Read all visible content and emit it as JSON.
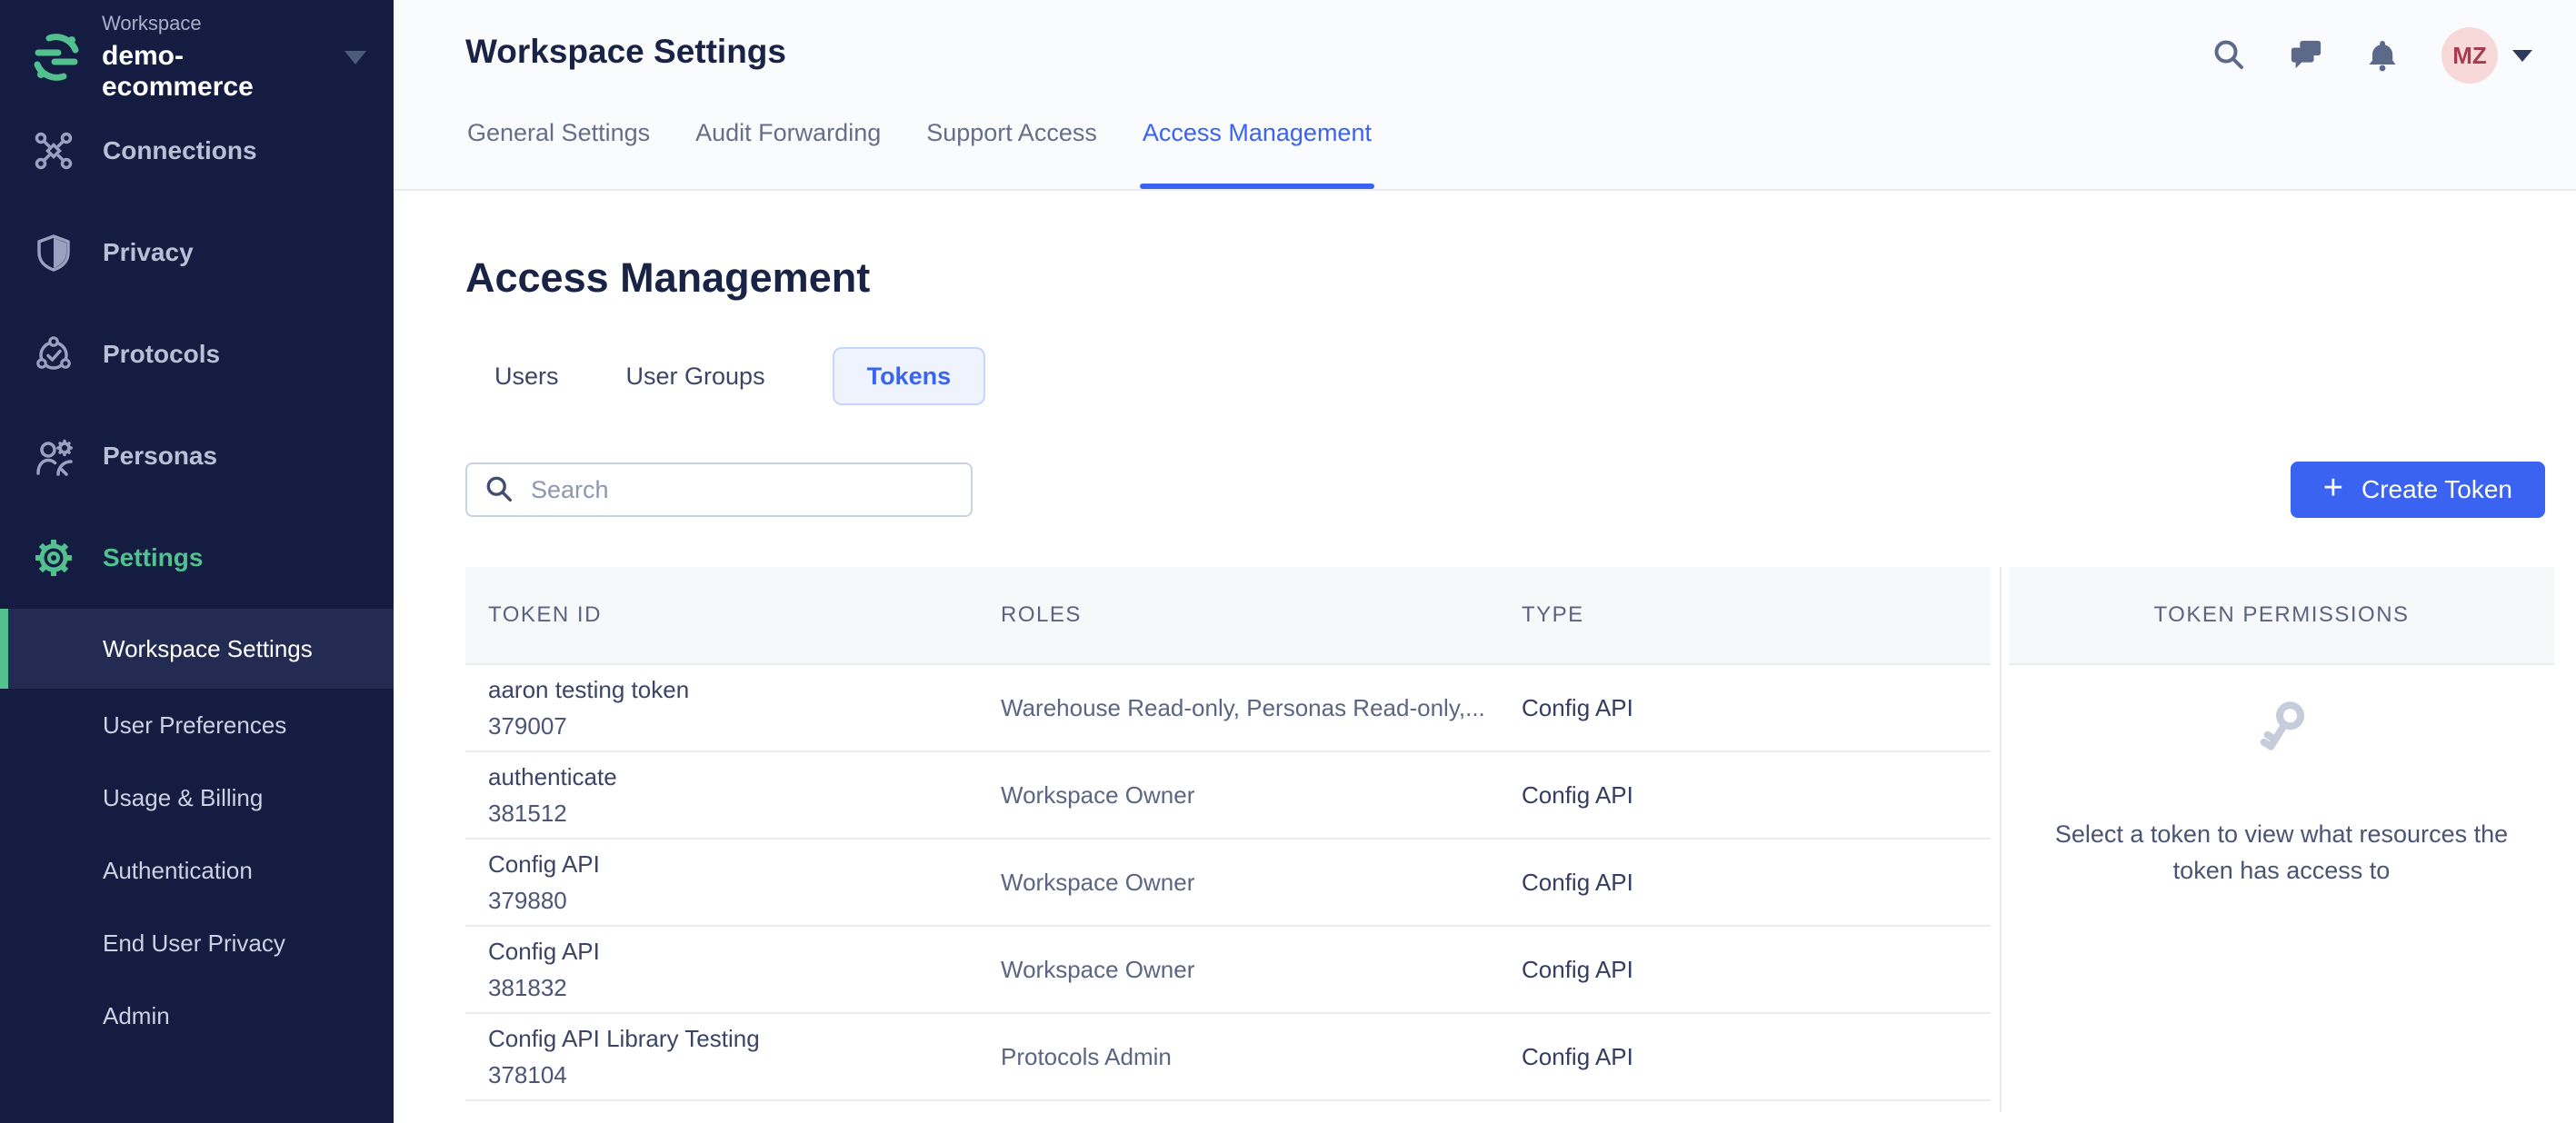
{
  "colors": {
    "sidebar_bg": "#141c41",
    "sidebar_active_bg": "#232b52",
    "brand_green": "#52c08f",
    "accent_blue": "#3a63f2",
    "active_pill_bg": "#eef3fe",
    "active_pill_border": "#c5d5fb",
    "topbar_bg": "#fafbfd",
    "table_header_bg": "#f7f8fa",
    "row_border": "#e9ecf3",
    "avatar_bg": "#f7d9d9",
    "avatar_text": "#a63c4e",
    "heading_text": "#192346"
  },
  "sidebar": {
    "logo_icon": "segment-logo-icon",
    "workspace_label": "Workspace",
    "workspace_name": "demo-ecommerce",
    "items": [
      {
        "label": "Connections",
        "icon": "connections-icon",
        "active": false
      },
      {
        "label": "Privacy",
        "icon": "privacy-shield-icon",
        "active": false
      },
      {
        "label": "Protocols",
        "icon": "protocols-icon",
        "active": false
      },
      {
        "label": "Personas",
        "icon": "personas-icon",
        "active": false
      },
      {
        "label": "Settings",
        "icon": "settings-gear-icon",
        "active": true
      }
    ],
    "settings_subitems": [
      {
        "label": "Workspace Settings",
        "active": true
      },
      {
        "label": "User Preferences",
        "active": false
      },
      {
        "label": "Usage & Billing",
        "active": false
      },
      {
        "label": "Authentication",
        "active": false
      },
      {
        "label": "End User Privacy",
        "active": false
      },
      {
        "label": "Admin",
        "active": false
      }
    ]
  },
  "topbar": {
    "title": "Workspace Settings",
    "tabs": [
      {
        "label": "General Settings",
        "active": false
      },
      {
        "label": "Audit Forwarding",
        "active": false
      },
      {
        "label": "Support Access",
        "active": false
      },
      {
        "label": "Access Management",
        "active": true
      }
    ],
    "icons": [
      "search-icon",
      "chat-bubbles-icon",
      "bell-icon"
    ],
    "avatar_initials": "MZ"
  },
  "main": {
    "heading": "Access Management",
    "subtabs": [
      {
        "label": "Users",
        "active": false
      },
      {
        "label": "User Groups",
        "active": false
      },
      {
        "label": "Tokens",
        "active": true
      }
    ],
    "search_placeholder": "Search",
    "create_token_plus": "+",
    "create_token_label": "Create Token",
    "table": {
      "columns": [
        "TOKEN ID",
        "ROLES",
        "TYPE"
      ],
      "rows": [
        {
          "name": "aaron testing token",
          "id": "379007",
          "roles": "Warehouse Read-only, Personas Read-only,...",
          "type": "Config API"
        },
        {
          "name": "authenticate",
          "id": "381512",
          "roles": "Workspace Owner",
          "type": "Config API"
        },
        {
          "name": "Config API",
          "id": "379880",
          "roles": "Workspace Owner",
          "type": "Config API"
        },
        {
          "name": "Config API",
          "id": "381832",
          "roles": "Workspace Owner",
          "type": "Config API"
        },
        {
          "name": "Config API Library Testing",
          "id": "378104",
          "roles": "Protocols Admin",
          "type": "Config API"
        }
      ]
    },
    "permissions_panel": {
      "header": "TOKEN PERMISSIONS",
      "icon": "key-icon",
      "empty_message": "Select a token to view what resources the token has access to"
    }
  }
}
